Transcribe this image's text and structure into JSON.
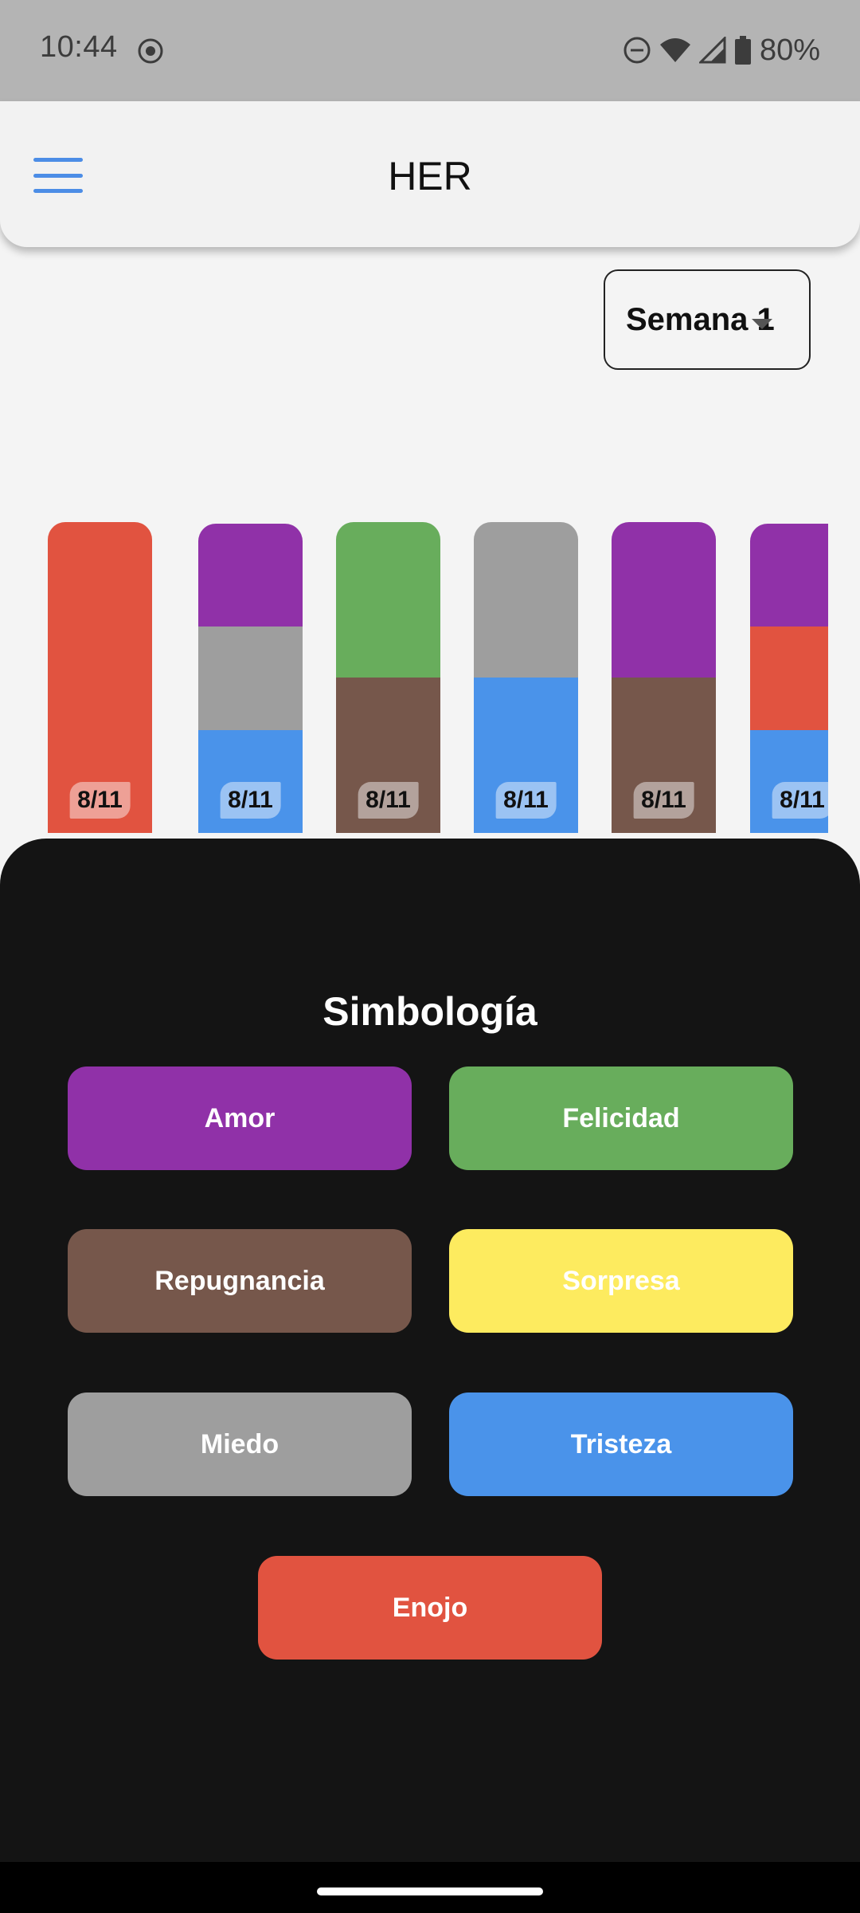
{
  "status_bar": {
    "time": "10:44",
    "battery": "80%"
  },
  "app_bar": {
    "title": "HER"
  },
  "week_selector": {
    "value": "Semana 1"
  },
  "colors": {
    "amor": "#9031a8",
    "felicidad": "#68ad5c",
    "repugnancia": "#76574b",
    "sorpresa": "#fdeb5f",
    "miedo": "#9e9e9e",
    "tristeza": "#4a93ea",
    "enojo": "#e15340"
  },
  "mood_bars": [
    {
      "date": "8/11",
      "segments": [
        "enojo",
        "enojo"
      ]
    },
    {
      "date": "8/11",
      "segments": [
        "amor",
        "miedo",
        "tristeza"
      ]
    },
    {
      "date": "8/11",
      "segments": [
        "felicidad",
        "repugnancia"
      ]
    },
    {
      "date": "8/11",
      "segments": [
        "miedo",
        "tristeza"
      ]
    },
    {
      "date": "8/11",
      "segments": [
        "amor",
        "repugnancia"
      ]
    },
    {
      "date": "8/11",
      "segments": [
        "amor",
        "enojo",
        "tristeza"
      ]
    }
  ],
  "legend": {
    "title": "Simbología",
    "items": [
      {
        "key": "amor",
        "label": "Amor"
      },
      {
        "key": "felicidad",
        "label": "Felicidad"
      },
      {
        "key": "repugnancia",
        "label": "Repugnancia"
      },
      {
        "key": "sorpresa",
        "label": "Sorpresa"
      },
      {
        "key": "miedo",
        "label": "Miedo"
      },
      {
        "key": "tristeza",
        "label": "Tristeza"
      },
      {
        "key": "enojo",
        "label": "Enojo"
      }
    ]
  }
}
